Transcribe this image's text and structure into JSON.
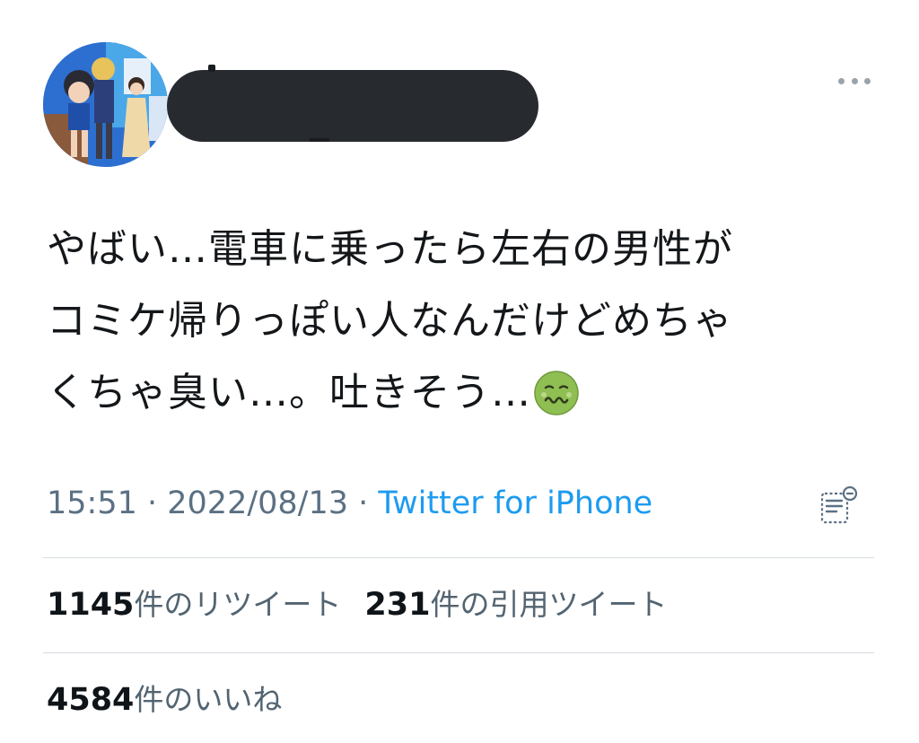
{
  "tweet": {
    "text_lines": [
      "やばい…電車に乗ったら左右の男性が",
      "コミケ帰りっぽい人なんだけどめちゃ",
      "くちゃ臭い…。吐きそう…"
    ],
    "emoji": "nauseated-face"
  },
  "meta": {
    "time": "15:51",
    "separator": " · ",
    "date": "2022/08/13",
    "source": "Twitter for iPhone"
  },
  "stats": {
    "retweets": {
      "count": "1145",
      "label": "件のリツイート"
    },
    "quotes": {
      "count": "231",
      "label": "件の引用ツイート"
    },
    "likes": {
      "count": "4584",
      "label": "件のいいね"
    }
  },
  "colors": {
    "link": "#1d9bf0",
    "meta_gray": "#5b7083",
    "text": "#14171a",
    "redaction": "#272b2f"
  }
}
